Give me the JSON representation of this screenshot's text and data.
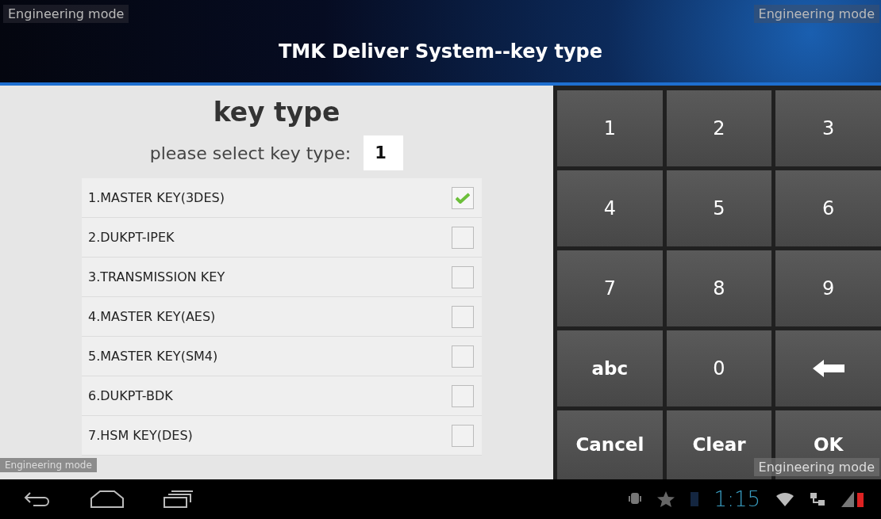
{
  "title_bar": {
    "title": "TMK Deliver System--key type"
  },
  "overlays": {
    "top_left": {
      "text": "Engineering mode"
    },
    "top_right": {
      "text": "Engineering mode"
    },
    "bottom_left": {
      "text": "Engineering mode"
    },
    "bottom_right": {
      "text": "Engineering mode"
    }
  },
  "panel": {
    "heading": "key type",
    "prompt": "please select key type:",
    "value": "1"
  },
  "options": [
    {
      "label": "1.MASTER KEY(3DES)",
      "checked": true
    },
    {
      "label": "2.DUKPT-IPEK",
      "checked": false
    },
    {
      "label": "3.TRANSMISSION KEY",
      "checked": false
    },
    {
      "label": "4.MASTER KEY(AES)",
      "checked": false
    },
    {
      "label": "5.MASTER KEY(SM4)",
      "checked": false
    },
    {
      "label": "6.DUKPT-BDK",
      "checked": false
    },
    {
      "label": "7.HSM KEY(DES)",
      "checked": false
    }
  ],
  "keypad": [
    {
      "kind": "digit",
      "label": "1"
    },
    {
      "kind": "digit",
      "label": "2"
    },
    {
      "kind": "digit",
      "label": "3"
    },
    {
      "kind": "digit",
      "label": "4"
    },
    {
      "kind": "digit",
      "label": "5"
    },
    {
      "kind": "digit",
      "label": "6"
    },
    {
      "kind": "digit",
      "label": "7"
    },
    {
      "kind": "digit",
      "label": "8"
    },
    {
      "kind": "digit",
      "label": "9"
    },
    {
      "kind": "text",
      "label": "abc"
    },
    {
      "kind": "digit",
      "label": "0"
    },
    {
      "kind": "backspace"
    },
    {
      "kind": "text",
      "label": "Cancel"
    },
    {
      "kind": "text",
      "label": "Clear"
    },
    {
      "kind": "text",
      "label": "OK"
    }
  ],
  "status_bar": {
    "time": "1:15"
  }
}
